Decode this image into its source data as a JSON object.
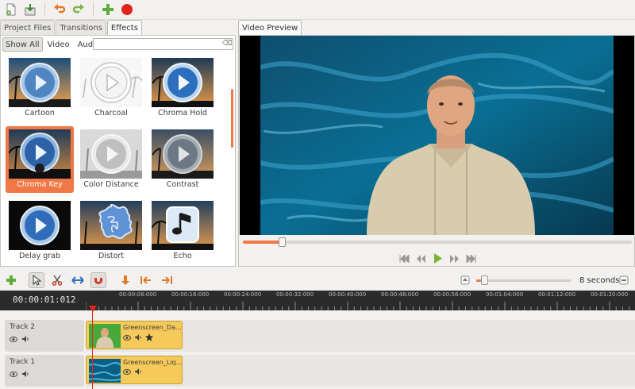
{
  "toolbar": {
    "items": [
      "new-project",
      "save-project",
      "undo",
      "redo",
      "add-track",
      "record"
    ]
  },
  "left_panel": {
    "tabs": [
      {
        "label": "Project Files"
      },
      {
        "label": "Transitions"
      },
      {
        "label": "Effects"
      }
    ],
    "filters": [
      {
        "label": "Show All"
      },
      {
        "label": "Video"
      },
      {
        "label": "Audio"
      }
    ],
    "filter_placeholder": "",
    "effects": [
      {
        "label": "Cartoon",
        "icon": "play-icon"
      },
      {
        "label": "Charcoal",
        "icon": "play-icon"
      },
      {
        "label": "Chroma Hold",
        "icon": "play-icon"
      },
      {
        "label": "Chroma Key",
        "icon": "play-icon"
      },
      {
        "label": "Color Distance",
        "icon": "play-icon"
      },
      {
        "label": "Contrast",
        "icon": "play-icon"
      },
      {
        "label": "Delay grab",
        "icon": "play-icon"
      },
      {
        "label": "Distort",
        "icon": "puzzle-icon"
      },
      {
        "label": "Echo",
        "icon": "music-note-icon"
      }
    ],
    "selected_effect": "Chroma Key"
  },
  "preview": {
    "tab_label": "Video Preview",
    "seek_progress": 0.1,
    "transport": [
      "jump-start",
      "rewind",
      "play",
      "fast-forward",
      "jump-end"
    ]
  },
  "timeline": {
    "zoom_label": "8 seconds",
    "zoom_level": 0.05,
    "timecode": "00:00:01:012",
    "ruler_labels": [
      "00:00:08:000",
      "00:00:16:000",
      "00:00:24:000",
      "00:00:32:000",
      "00:00:40:000",
      "00:00:48:000",
      "00:00:56:000",
      "00:01:04:000",
      "00:01:12:000",
      "00:01:20:000"
    ],
    "tracks": [
      {
        "name": "Track 2",
        "clip_title": "Greenscreen_Da..."
      },
      {
        "name": "Track 1",
        "clip_title": "Greenscreen_Liq..."
      }
    ]
  },
  "colors": {
    "accent": "#f07746",
    "playhead": "#e2261d",
    "clip": "#f5c95a",
    "ruler_bg": "#2b2b2b"
  }
}
